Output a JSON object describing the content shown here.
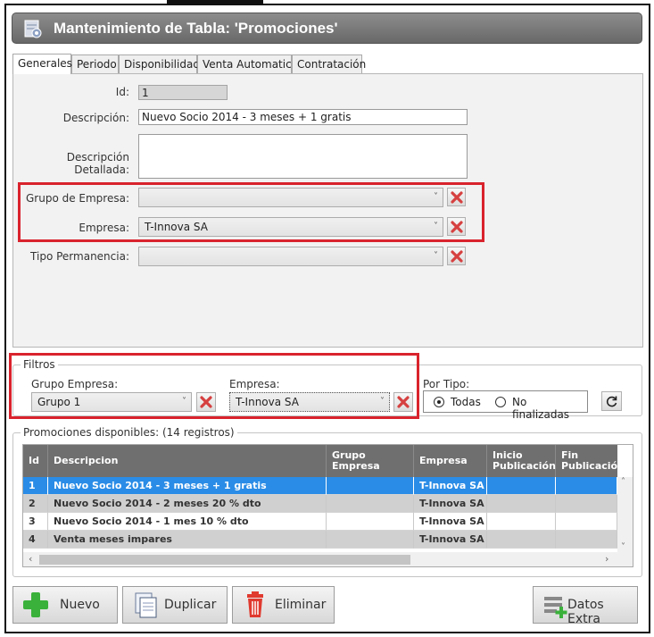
{
  "window": {
    "title": "Mantenimiento de Tabla: 'Promociones'"
  },
  "tabs": [
    {
      "label": "Generales",
      "active": true
    },
    {
      "label": "Periodo"
    },
    {
      "label": "Disponibilidad"
    },
    {
      "label": "Venta Automatica"
    },
    {
      "label": "Contratación"
    }
  ],
  "form": {
    "id_label": "Id:",
    "id_value": "1",
    "descripcion_label": "Descripción:",
    "descripcion_value": "Nuevo Socio 2014 - 3 meses + 1 gratis",
    "detallada_label": "Descripción Detallada:",
    "detallada_value": "",
    "grupo_label": "Grupo de Empresa:",
    "grupo_value": "",
    "empresa_label": "Empresa:",
    "empresa_value": "T-Innova SA",
    "permanencia_label": "Tipo Permanencia:",
    "permanencia_value": ""
  },
  "filtros": {
    "legend": "Filtros",
    "grupo_label": "Grupo Empresa:",
    "grupo_value": "Grupo 1",
    "empresa_label": "Empresa:",
    "empresa_value": "T-Innova SA",
    "tipo_label": "Por Tipo:",
    "opt_todas": "Todas",
    "opt_nofin": "No finalizadas",
    "selected": "Todas"
  },
  "grid": {
    "legend": "Promociones disponibles:  (14 registros)",
    "columns": [
      "Id",
      "Descripcion",
      "Grupo Empresa",
      "Empresa",
      "Inicio\nPublicación",
      "Fin\nPublicación"
    ],
    "rows": [
      {
        "id": "1",
        "descripcion": "Nuevo Socio 2014 - 3 meses + 1 gratis",
        "grupo": "",
        "empresa": "T-Innova SA",
        "inicio": "",
        "fin": ""
      },
      {
        "id": "2",
        "descripcion": "Nuevo Socio 2014 - 2 meses 20 % dto",
        "grupo": "",
        "empresa": "T-Innova SA",
        "inicio": "",
        "fin": ""
      },
      {
        "id": "3",
        "descripcion": "Nuevo Socio 2014 - 1 mes 10 % dto",
        "grupo": "",
        "empresa": "T-Innova SA",
        "inicio": "",
        "fin": ""
      },
      {
        "id": "4",
        "descripcion": "Venta meses impares",
        "grupo": "",
        "empresa": "T-Innova SA",
        "inicio": "",
        "fin": ""
      }
    ]
  },
  "buttons": {
    "nuevo": "Nuevo",
    "duplicar": "Duplicar",
    "eliminar": "Eliminar",
    "extra": "Datos Extra"
  },
  "colors": {
    "title_bar": "#6f6f6f",
    "selection": "#2a8ce6",
    "highlight_box": "#d9232d",
    "add_green": "#3ab13a",
    "delete_red": "#e03a2f"
  }
}
